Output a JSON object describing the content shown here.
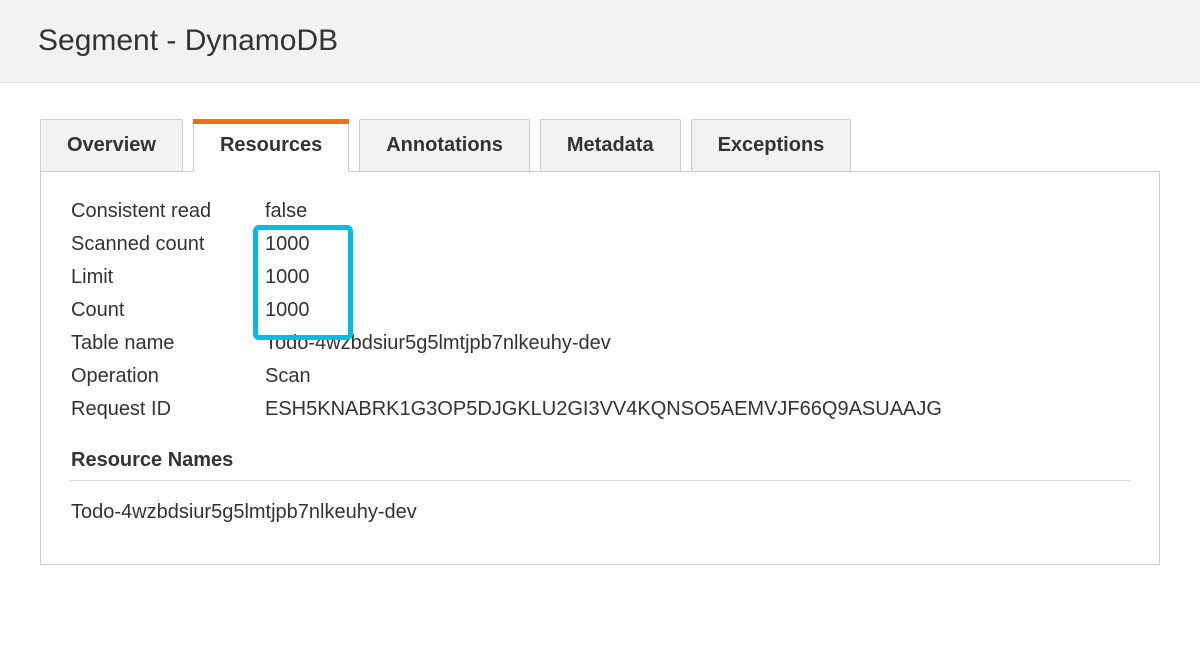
{
  "header": {
    "title": "Segment - DynamoDB"
  },
  "tabs": {
    "overview": "Overview",
    "resources": "Resources",
    "annotations": "Annotations",
    "metadata": "Metadata",
    "exceptions": "Exceptions"
  },
  "details": {
    "consistent_read": {
      "label": "Consistent read",
      "value": "false"
    },
    "scanned_count": {
      "label": "Scanned count",
      "value": "1000"
    },
    "limit": {
      "label": "Limit",
      "value": "1000"
    },
    "count": {
      "label": "Count",
      "value": "1000"
    },
    "table_name": {
      "label": "Table name",
      "value": "Todo-4wzbdsiur5g5lmtjpb7nlkeuhy-dev"
    },
    "operation": {
      "label": "Operation",
      "value": "Scan"
    },
    "request_id": {
      "label": "Request ID",
      "value": "ESH5KNABRK1G3OP5DJGKLU2GI3VV4KQNSO5AEMVJF66Q9ASUAAJG"
    }
  },
  "resource_names": {
    "title": "Resource Names",
    "value": "Todo-4wzbdsiur5g5lmtjpb7nlkeuhy-dev"
  }
}
